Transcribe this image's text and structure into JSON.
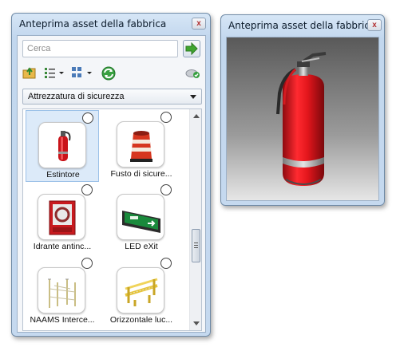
{
  "asset_browser": {
    "title": "Anteprima asset della fabbrica",
    "close_label": "x",
    "search": {
      "placeholder": "Cerca"
    },
    "category": {
      "selected": "Attrezzatura di sicurezza"
    },
    "items": [
      {
        "label": "Estintore",
        "icon": "fire-extinguisher-icon",
        "selected": true
      },
      {
        "label": "Fusto di sicure...",
        "icon": "safety-drum-icon",
        "selected": false
      },
      {
        "label": "Idrante antinc...",
        "icon": "fire-hydrant-cabinet-icon",
        "selected": false
      },
      {
        "label": "LED eXit",
        "icon": "exit-sign-icon",
        "selected": false
      },
      {
        "label": "NAAMS Interce...",
        "icon": "naams-fence-icon",
        "selected": false
      },
      {
        "label": "Orizzontale luc...",
        "icon": "horizontal-light-barrier-icon",
        "selected": false
      }
    ]
  },
  "preview": {
    "title": "Anteprima asset della fabbrica",
    "close_label": "x",
    "image": "fire-extinguisher-preview"
  },
  "colors": {
    "selection": "#dceaf9",
    "extinguisher_red": "#d8141b",
    "go_green": "#3fa52f"
  }
}
